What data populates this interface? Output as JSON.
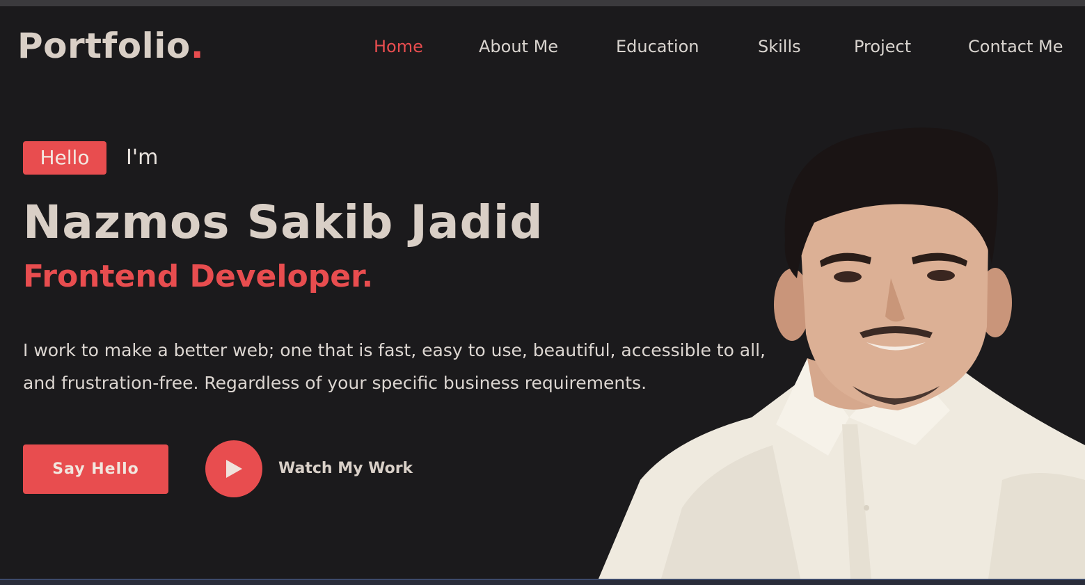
{
  "header": {
    "logo_text": "Portfolio",
    "logo_dot": ".",
    "nav": [
      {
        "label": "Home",
        "active": true
      },
      {
        "label": "About Me",
        "active": false
      },
      {
        "label": "Education",
        "active": false
      },
      {
        "label": "Skills",
        "active": false
      },
      {
        "label": "Project",
        "active": false
      },
      {
        "label": "Contact Me",
        "active": false
      }
    ]
  },
  "hero": {
    "hello_tag": "Hello",
    "intro": "I'm",
    "name": "Nazmos Sakib Jadid",
    "role": "Frontend Developer.",
    "bio_line1": "I work to make a better web; one that is fast, easy to use, beautiful, accessible to all,",
    "bio_line2": "and frustration-free. Regardless of your specific business requirements.",
    "cta_label": "Say Hello",
    "watch_label": "Watch My Work"
  },
  "colors": {
    "background": "#1b1a1c",
    "accent": "#e84d4f",
    "heading": "#d9cfc6",
    "text": "#dcd6d1"
  },
  "icons": {
    "play": "play-icon"
  }
}
